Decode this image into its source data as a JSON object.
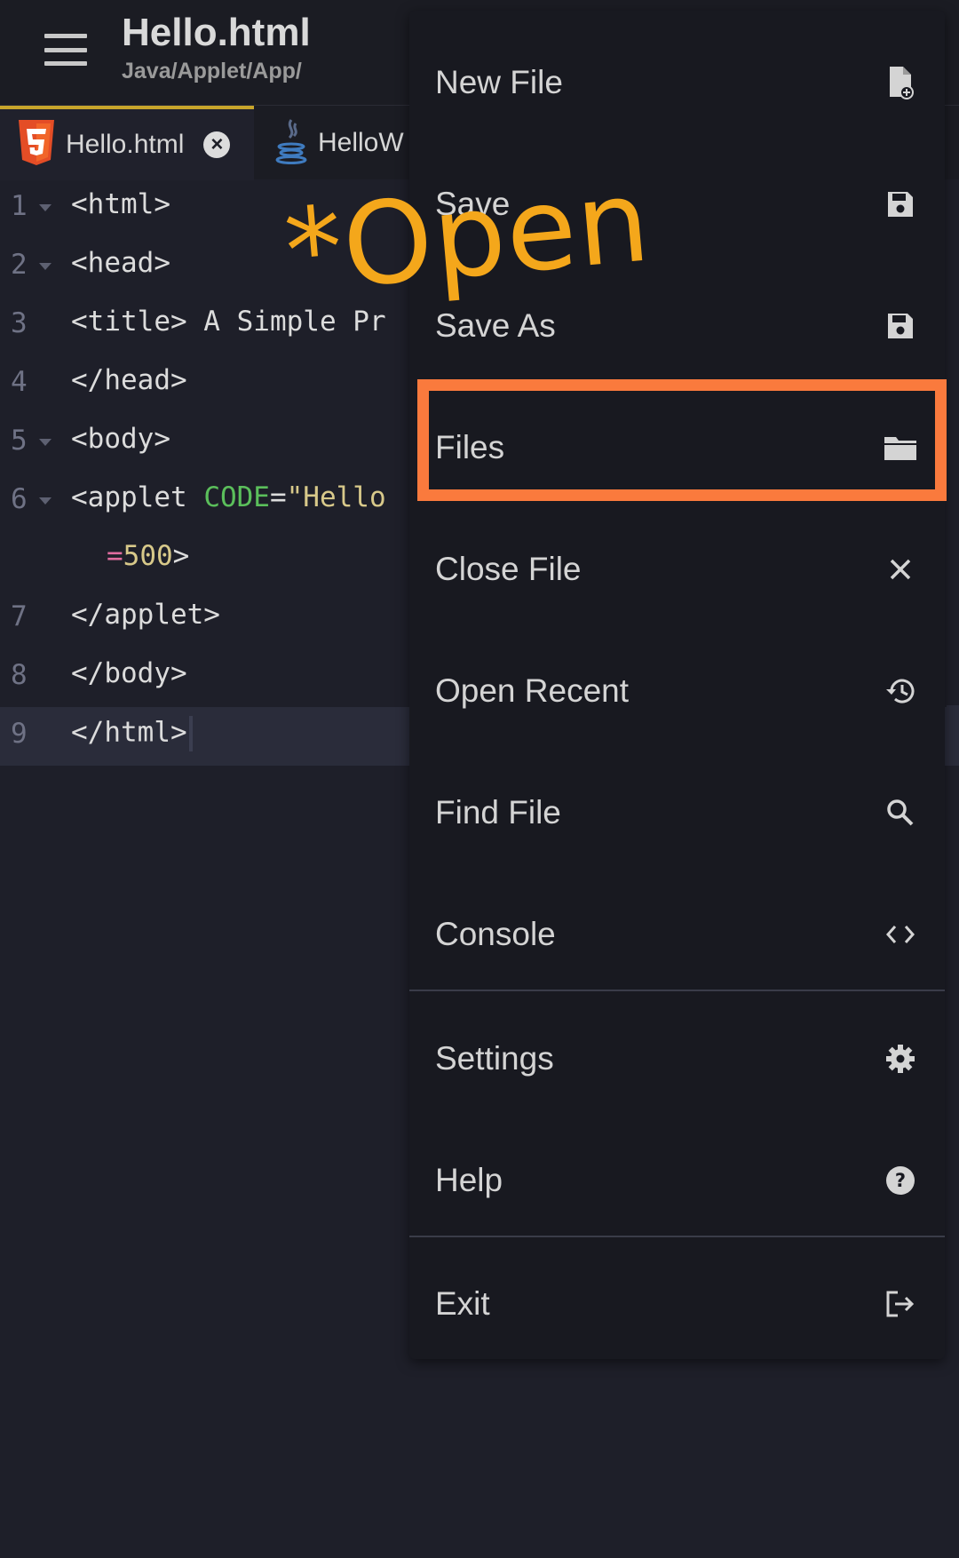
{
  "header": {
    "title": "Hello.html",
    "subtitle": "Java/Applet/App/",
    "menu_icon": "hamburger-icon"
  },
  "tabs": [
    {
      "label": "Hello.html",
      "icon": "html5-icon",
      "active": true,
      "close_icon": "close-circle-icon"
    },
    {
      "label": "HelloW",
      "icon": "java-icon",
      "active": false
    }
  ],
  "editor": {
    "lines": [
      {
        "number": "1",
        "text": "<html>"
      },
      {
        "number": "2",
        "text": "<head>"
      },
      {
        "number": "3",
        "text": "<title> A Simple Pr"
      },
      {
        "number": "4",
        "text": "</head>"
      },
      {
        "number": "5",
        "text": "<body>"
      },
      {
        "number": "6",
        "text_tag": "<applet ",
        "text_attr": "CODE",
        "text_eq": "=",
        "text_str": "\"Hello"
      },
      {
        "number": "",
        "text_eq": "=",
        "text_num": "500",
        "text_end": ">"
      },
      {
        "number": "7",
        "text": "</applet>"
      },
      {
        "number": "8",
        "text": "</body>"
      },
      {
        "number": "9",
        "text": "</html>"
      }
    ]
  },
  "annotation": {
    "text": "*Open",
    "color": "#f4a71b"
  },
  "menu": {
    "items": [
      {
        "label": "New File",
        "icon": "new-file-icon"
      },
      {
        "label": "Save",
        "icon": "save-icon"
      },
      {
        "label": "Save As",
        "icon": "save-as-icon"
      },
      {
        "label": "Files",
        "icon": "folder-icon",
        "highlighted": true
      },
      {
        "label": "Close File",
        "icon": "close-icon"
      },
      {
        "label": "Open Recent",
        "icon": "history-icon"
      },
      {
        "label": "Find File",
        "icon": "search-icon"
      },
      {
        "label": "Console",
        "icon": "code-icon"
      },
      {
        "label": "Settings",
        "icon": "gear-icon"
      },
      {
        "label": "Help",
        "icon": "help-icon"
      },
      {
        "label": "Exit",
        "icon": "exit-icon"
      }
    ],
    "highlight_color": "#fa7a3d"
  }
}
